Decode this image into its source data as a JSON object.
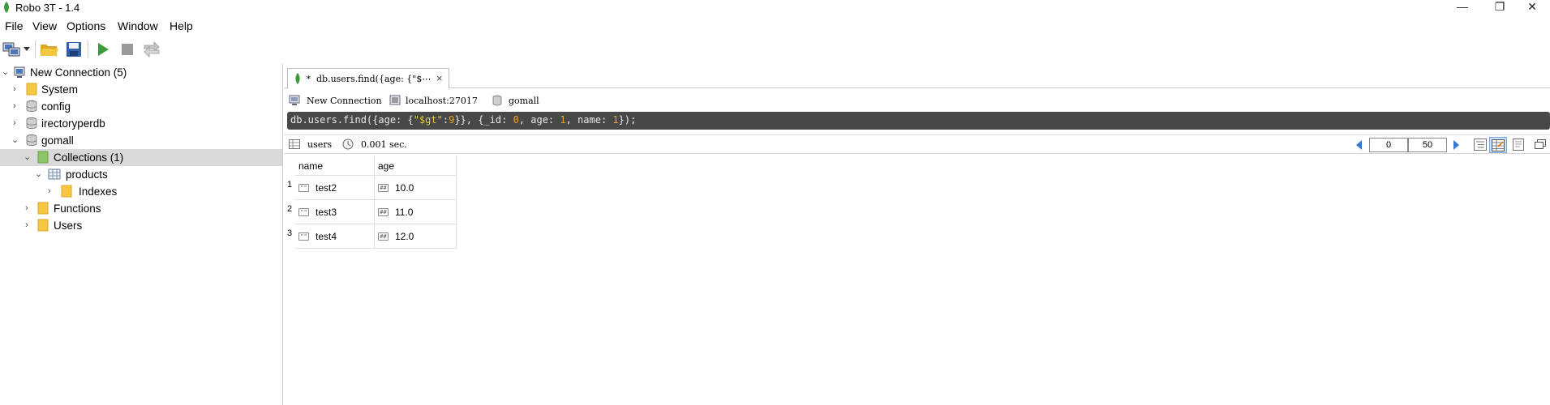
{
  "window": {
    "title": "Robo 3T - 1.4",
    "minimize": "—",
    "maximize": "❐",
    "close": "✕"
  },
  "menu": [
    "File",
    "View",
    "Options",
    "Window",
    "Help"
  ],
  "tree": {
    "connection": "New Connection (5)",
    "items": [
      {
        "label": "System",
        "icon": "folder-icon"
      },
      {
        "label": "config",
        "icon": "database-icon"
      },
      {
        "label": "irectoryperdb",
        "icon": "database-icon"
      },
      {
        "label": "gomall",
        "icon": "database-icon"
      },
      {
        "label": "Collections (1)",
        "icon": "collections-folder-icon"
      },
      {
        "label": "products",
        "icon": "collection-table-icon"
      },
      {
        "label": "Indexes",
        "icon": "folder-icon"
      },
      {
        "label": "Functions",
        "icon": "folder-icon"
      },
      {
        "label": "Users",
        "icon": "folder-icon"
      }
    ]
  },
  "tab": {
    "star": "*",
    "label": "db.users.find({age: {\"$⋯",
    "close": "×"
  },
  "connection_info": {
    "connection": "New Connection",
    "host": "localhost:27017",
    "database": "gomall"
  },
  "query": {
    "p1": "db.users.find({age: {",
    "s1": "\"$gt\"",
    "p2": ":",
    "n1": "9",
    "p3": "}}, {_id: ",
    "n2": "0",
    "p4": ", age: ",
    "n3": "1",
    "p5": ", name: ",
    "n4": "1",
    "p6": "});"
  },
  "result": {
    "collection": "users",
    "time": "0.001 sec.",
    "skip": "0",
    "limit": "50"
  },
  "table": {
    "columns": [
      "name",
      "age"
    ],
    "rows": [
      {
        "num": "1",
        "name": "test2",
        "age": "10.0"
      },
      {
        "num": "2",
        "name": "test3",
        "age": "11.0"
      },
      {
        "num": "3",
        "name": "test4",
        "age": "12.0"
      }
    ],
    "string_glyph": "\"\"",
    "number_glyph": "##"
  },
  "colors": {
    "accent_green": "#3c9a3c",
    "folder_yellow": "#f5c842",
    "query_bg": "#484848",
    "selected_row": "#d9d9d9"
  }
}
